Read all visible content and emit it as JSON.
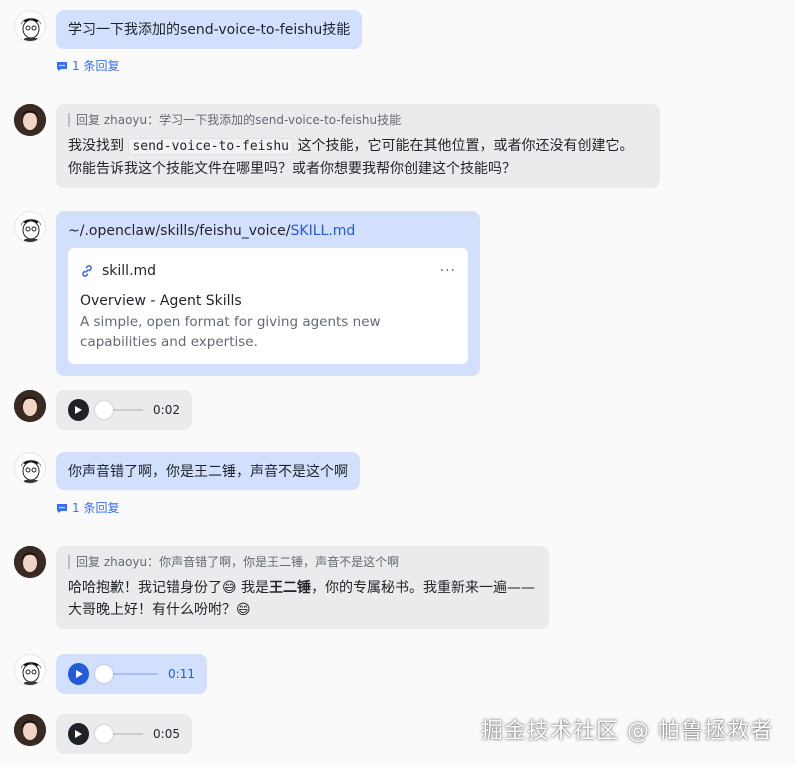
{
  "messages": {
    "m1": {
      "text": "学习一下我添加的send-voice-to-feishu技能",
      "reply_count": "1 条回复"
    },
    "m2": {
      "quote": "回复 zhaoyu：学习一下我添加的send-voice-to-feishu技能",
      "line1_pre": "我没找到 ",
      "line1_code": "send-voice-to-feishu",
      "line1_post": " 这个技能，它可能在其他位置，或者你还没有创建它。",
      "line2": "你能告诉我这个技能文件在哪里吗？或者你想要我帮你创建这个技能吗？"
    },
    "m3": {
      "path_prefix": "~/.openclaw/skills/feishu_voice/",
      "path_link": "SKILL.md",
      "card_title": "skill.md",
      "card_more": "···",
      "card_heading": "Overview - Agent Skills",
      "card_desc": "A simple, open format for giving agents new capabilities and expertise."
    },
    "m4": {
      "duration": "0:02"
    },
    "m5": {
      "text": "你声音错了啊，你是王二锤，声音不是这个啊",
      "reply_count": "1 条回复"
    },
    "m6": {
      "quote": "回复 zhaoyu：你声音错了啊，你是王二锤，声音不是这个啊",
      "line1_pre": "哈哈抱歉！我记错身份了",
      "emoji1": "😅",
      "line1_mid": " 我是",
      "line1_bold": "王二锤",
      "line1_post": "，你的专属秘书。我重新来一遍——",
      "line2_pre": "大哥晚上好！有什么吩咐？",
      "emoji2": "😄"
    },
    "m7": {
      "duration": "0:11"
    },
    "m8": {
      "duration": "0:05"
    }
  },
  "watermark": "掘金技术社区 @ 帕鲁拯救者",
  "colors": {
    "user_bubble": "#d3e0fd",
    "bot_bubble": "#ebebed",
    "accent": "#3370ff"
  },
  "icons": [
    "user-avatar",
    "bot-avatar",
    "reply-thread-icon",
    "link-icon",
    "more-icon",
    "play-icon"
  ]
}
